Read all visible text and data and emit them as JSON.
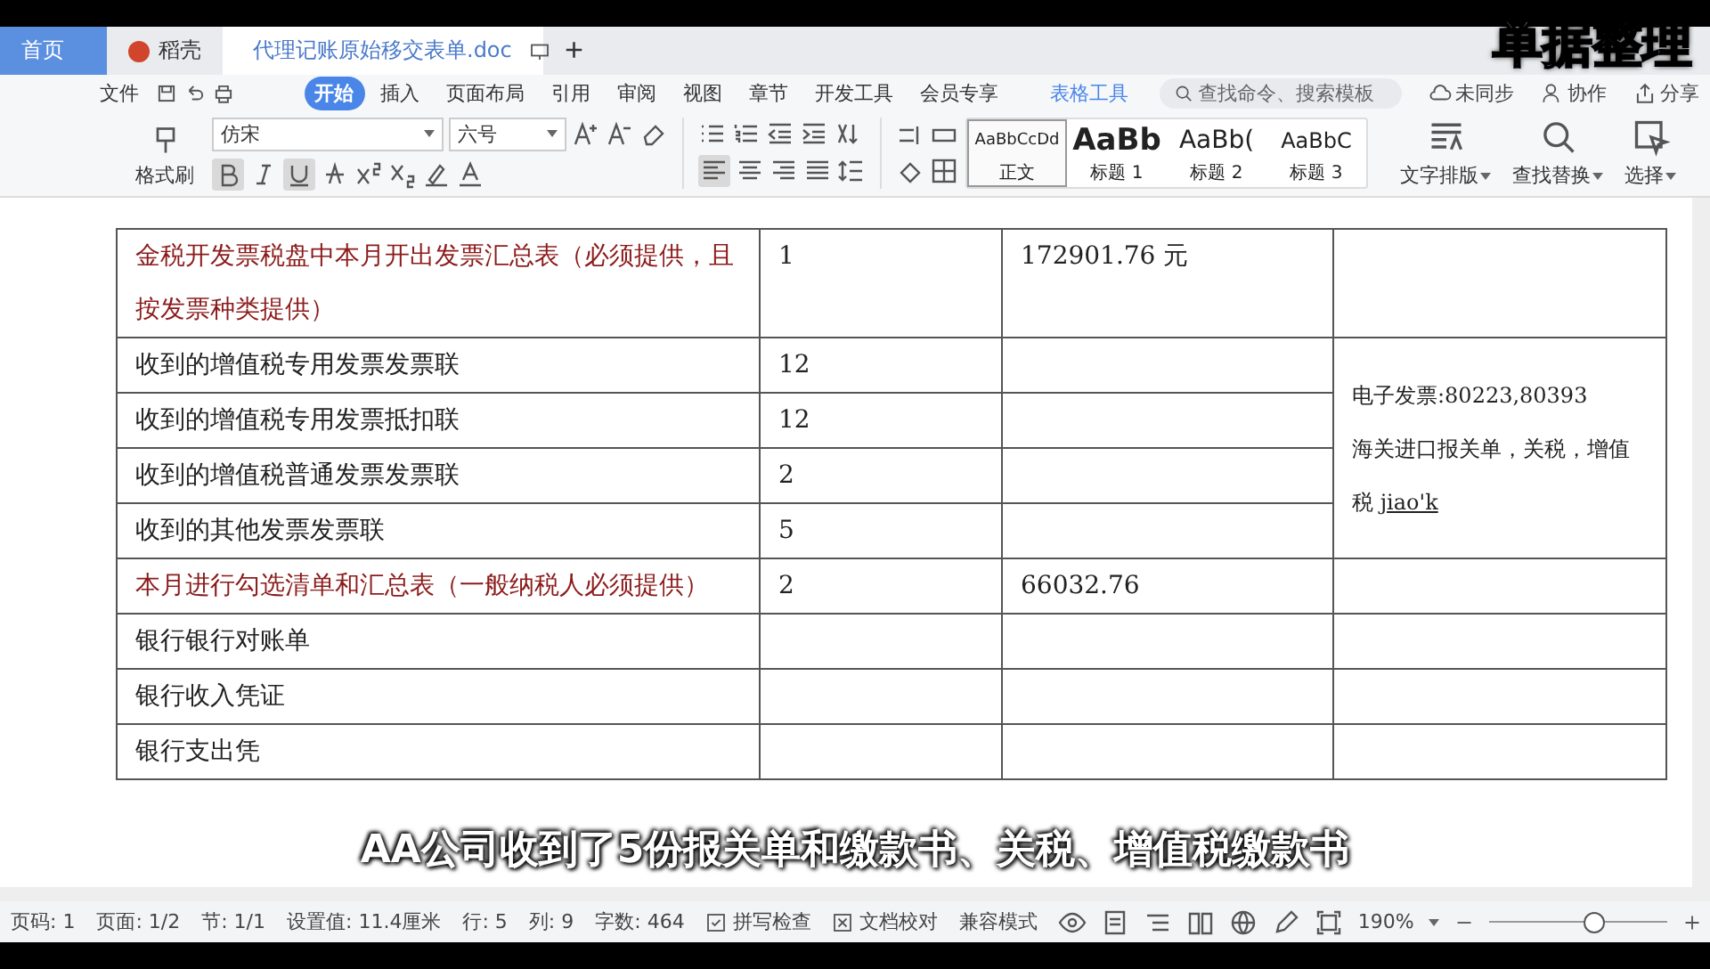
{
  "tabs": [
    {
      "label": "首页",
      "kind": "home",
      "selected": false
    },
    {
      "label": "稻壳",
      "kind": "docer",
      "selected": false
    },
    {
      "label": "代理记账原始移交表单.doc",
      "kind": "doc",
      "selected": true
    }
  ],
  "new_tab": "+",
  "overlay_title": "单据整理",
  "file_menu": "文件",
  "menu": [
    {
      "label": "开始",
      "selected": true,
      "kind": "tab"
    },
    {
      "label": "插入",
      "selected": false,
      "kind": "tab"
    },
    {
      "label": "页面布局",
      "selected": false,
      "kind": "tab"
    },
    {
      "label": "引用",
      "selected": false,
      "kind": "tab"
    },
    {
      "label": "审阅",
      "selected": false,
      "kind": "tab"
    },
    {
      "label": "视图",
      "selected": false,
      "kind": "tab"
    },
    {
      "label": "章节",
      "selected": false,
      "kind": "tab"
    },
    {
      "label": "开发工具",
      "selected": false,
      "kind": "tab"
    },
    {
      "label": "会员专享",
      "selected": false,
      "kind": "tab"
    },
    {
      "label": "表格工具",
      "selected": false,
      "kind": "context"
    }
  ],
  "search": {
    "placeholder": "查找命令、搜索模板"
  },
  "actions": [
    {
      "label": "未同步",
      "kind": "cloud"
    },
    {
      "label": "协作",
      "kind": "person"
    },
    {
      "label": "分享",
      "kind": "share"
    }
  ],
  "ribbon": {
    "format_painter": "格式刷",
    "font": "仿宋",
    "size": "六号",
    "styles": [
      {
        "preview": "AaBbCcDd",
        "label": "正文",
        "selected": true,
        "kind": "body"
      },
      {
        "preview": "AaBb",
        "label": "标题 1",
        "selected": false,
        "kind": "h1"
      },
      {
        "preview": "AaBb(",
        "label": "标题 2",
        "selected": false,
        "kind": "h2"
      },
      {
        "preview": "AaBbC",
        "label": "标题 3",
        "selected": false,
        "kind": "h3"
      }
    ],
    "tools": [
      {
        "label": "文字排版",
        "kind": "layout"
      },
      {
        "label": "查找替换",
        "kind": "find"
      },
      {
        "label": "选择",
        "kind": "select"
      }
    ]
  },
  "table": {
    "groups": [
      {
        "rows": [
          {
            "item": "金税开发票税盘中本月开出发票汇总表（必须提供，且按发票种类提供）",
            "count": "1",
            "amount": "172901.76 元",
            "emphasis": true
          }
        ]
      },
      {
        "rows": [
          {
            "item": "收到的增值税专用发票发票联",
            "count": "12",
            "emphasis": false
          },
          {
            "item": "收到的增值税专用发票抵扣联",
            "count": "12",
            "emphasis": false
          },
          {
            "item": "收到的增值税普通发票发票联",
            "count": "2",
            "emphasis": false
          },
          {
            "item": "收到的其他发票发票联",
            "count": "5",
            "emphasis": false
          }
        ],
        "note": {
          "lines": [
            "电子发票:80223,80393",
            "海关进口报关单，关税，增值税"
          ],
          "composing": "jiao'k"
        }
      },
      {
        "rows": [
          {
            "item": "本月进行勾选清单和汇总表（一般纳税人必须提供）",
            "count": "2",
            "amount": "66032.76",
            "emphasis": true
          }
        ]
      },
      {
        "rows": [
          {
            "item": "银行银行对账单",
            "emphasis": false
          }
        ]
      },
      {
        "rows": [
          {
            "item": "银行收入凭证",
            "emphasis": false
          }
        ]
      },
      {
        "rows": [
          {
            "item": "银行支出凭",
            "emphasis": false
          }
        ]
      }
    ]
  },
  "subtitle": "AA公司收到了5份报关单和缴款书、关税、增值税缴款书",
  "status": {
    "items": [
      {
        "label": "页码: 1",
        "kind": "text"
      },
      {
        "label": "页面: 1/2",
        "kind": "text"
      },
      {
        "label": "节: 1/1",
        "kind": "text"
      },
      {
        "label": "设置值: 11.4厘米",
        "kind": "text"
      },
      {
        "label": "行: 5",
        "kind": "text"
      },
      {
        "label": "列: 9",
        "kind": "text"
      },
      {
        "label": "字数: 464",
        "kind": "text"
      },
      {
        "label": "拼写检查",
        "kind": "check"
      },
      {
        "label": "文档校对",
        "kind": "cross"
      },
      {
        "label": "兼容模式",
        "kind": "text"
      }
    ],
    "zoom": "190%",
    "zoom_slider": {
      "level": 0.59
    }
  }
}
